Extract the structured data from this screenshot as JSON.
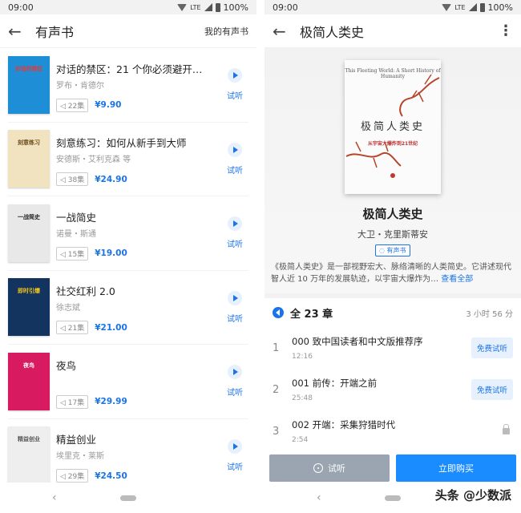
{
  "left": {
    "status": {
      "time": "09:00",
      "network": "LTE",
      "battery": "100%"
    },
    "title": "有声书",
    "my_link": "我的有声书",
    "books": [
      {
        "title": "对话的禁区：21 个你必须避开的沟…",
        "author": "罗布・肯德尔",
        "episodes": "22集",
        "price": "¥9.90",
        "try": "试听",
        "cover_bg": "#1e8fd6",
        "cover_text": "对话的禁区",
        "cover_fg": "#e53935"
      },
      {
        "title": "刻意练习：如何从新手到大师",
        "author": "安德斯・艾利克森 等",
        "episodes": "38集",
        "price": "¥24.90",
        "try": "试听",
        "cover_bg": "#f2e3c0",
        "cover_text": "刻意练习",
        "cover_fg": "#6d4c1f"
      },
      {
        "title": "一战简史",
        "author": "诺曼・斯通",
        "episodes": "15集",
        "price": "¥19.00",
        "try": "试听",
        "cover_bg": "#e8e8e8",
        "cover_text": "一战简史",
        "cover_fg": "#222222"
      },
      {
        "title": "社交红利 2.0",
        "author": "徐志斌",
        "episodes": "21集",
        "price": "¥21.00",
        "try": "试听",
        "cover_bg": "#12345e",
        "cover_text": "即时引爆",
        "cover_fg": "#f5c518"
      },
      {
        "title": "夜鸟",
        "author": "",
        "episodes": "17集",
        "price": "¥29.99",
        "try": "试听",
        "cover_bg": "#d81b60",
        "cover_text": "夜鸟",
        "cover_fg": "#ffffff"
      },
      {
        "title": "精益创业",
        "author": "埃里克・莱斯",
        "episodes": "29集",
        "price": "¥24.50",
        "try": "试听",
        "cover_bg": "#eeeeee",
        "cover_text": "精益创业",
        "cover_fg": "#555555"
      }
    ]
  },
  "right": {
    "status": {
      "time": "09:00",
      "network": "LTE",
      "battery": "100%"
    },
    "title": "极简人类史",
    "cover": {
      "en": "This Fleeting World: A Short History of Humanity",
      "cn": "极简人类史",
      "sub": "从宇宙大爆炸到21世纪"
    },
    "book_title": "极简人类史",
    "author": "大卫・克里斯蒂安",
    "badge": "有声书",
    "description": "《极简人类史》是一部视野宏大、脉络清晰的人类简史。它讲述现代智人近 10 万年的发展轨迹，以宇宙大爆炸为…",
    "more": "查看全部",
    "chapters_total": "全 23 章",
    "duration": "3 小时 56 分",
    "chapters": [
      {
        "num": "1",
        "title": "000 致中国读者和中文版推荐序",
        "time": "12:16",
        "action": "免费试听"
      },
      {
        "num": "2",
        "title": "001 前传：开端之前",
        "time": "25:48",
        "action": "免费试听"
      },
      {
        "num": "3",
        "title": "002 开端：采集狩猎时代",
        "time": "2:54",
        "action": ""
      }
    ],
    "try_btn": "试听",
    "buy_btn": "立即购买"
  },
  "watermark": "头条 @少数派",
  "colors": {
    "accent": "#1a73e8",
    "buy": "#1a8cff",
    "try_btn": "#9aa5b1"
  }
}
